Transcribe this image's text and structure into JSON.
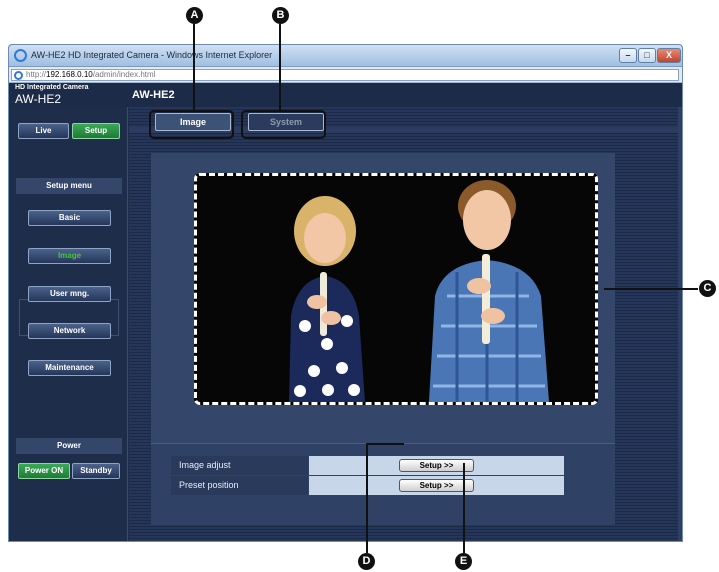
{
  "callouts": {
    "a": "A",
    "b": "B",
    "c": "C",
    "d": "D",
    "e": "E"
  },
  "window": {
    "title": "AW-HE2 HD Integrated Camera - Windows Internet Explorer",
    "minimize": "–",
    "maximize": "□",
    "close": "X"
  },
  "address": {
    "prefix": "http://",
    "host": "192.168.0.10",
    "path": "/admin/index.html"
  },
  "header": {
    "brand_small": "HD Integrated Camera",
    "brand_model": "AW-HE2",
    "title": "AW-HE2"
  },
  "sidebar": {
    "live": "Live",
    "setup": "Setup",
    "setup_menu": "Setup menu",
    "basic": "Basic",
    "image": "Image",
    "user_mng": "User mng.",
    "network": "Network",
    "maintenance": "Maintenance",
    "power": "Power",
    "power_on": "Power ON",
    "standby": "Standby"
  },
  "tabs": {
    "image": "Image",
    "system": "System"
  },
  "controls": {
    "rows": [
      {
        "label": "Image adjust",
        "button": "Setup >>"
      },
      {
        "label": "Preset position",
        "button": "Setup >>"
      }
    ]
  },
  "colors": {
    "page_bg": "#1e2d4a",
    "active_green": "#2f9a4a",
    "active_text": "#49c43e",
    "accent_border": "#a9b9d0"
  }
}
